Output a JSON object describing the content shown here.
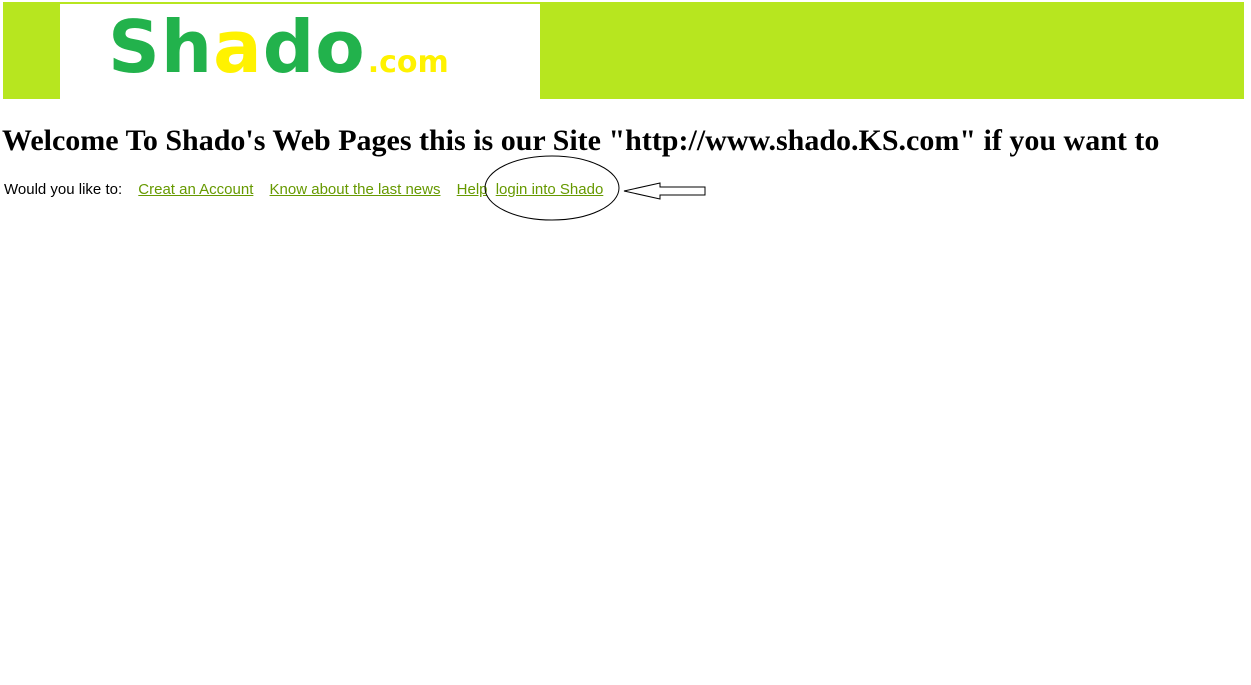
{
  "header": {
    "logo": {
      "part1": "Sh",
      "part2": "ado",
      "suffix": ".com"
    }
  },
  "colors": {
    "banner": "#b7e61f",
    "logo_green": "#22b24c",
    "logo_yellow": "#fff200",
    "link": "#669900"
  },
  "main": {
    "welcome": "Welcome To Shado's Web Pages this is our Site \"http://www.shado.KS.com\" if you want to",
    "nav_prompt": "Would you like to:",
    "links": [
      "Creat an Account",
      "Know about the last news",
      "Help",
      "login into Shado"
    ]
  }
}
